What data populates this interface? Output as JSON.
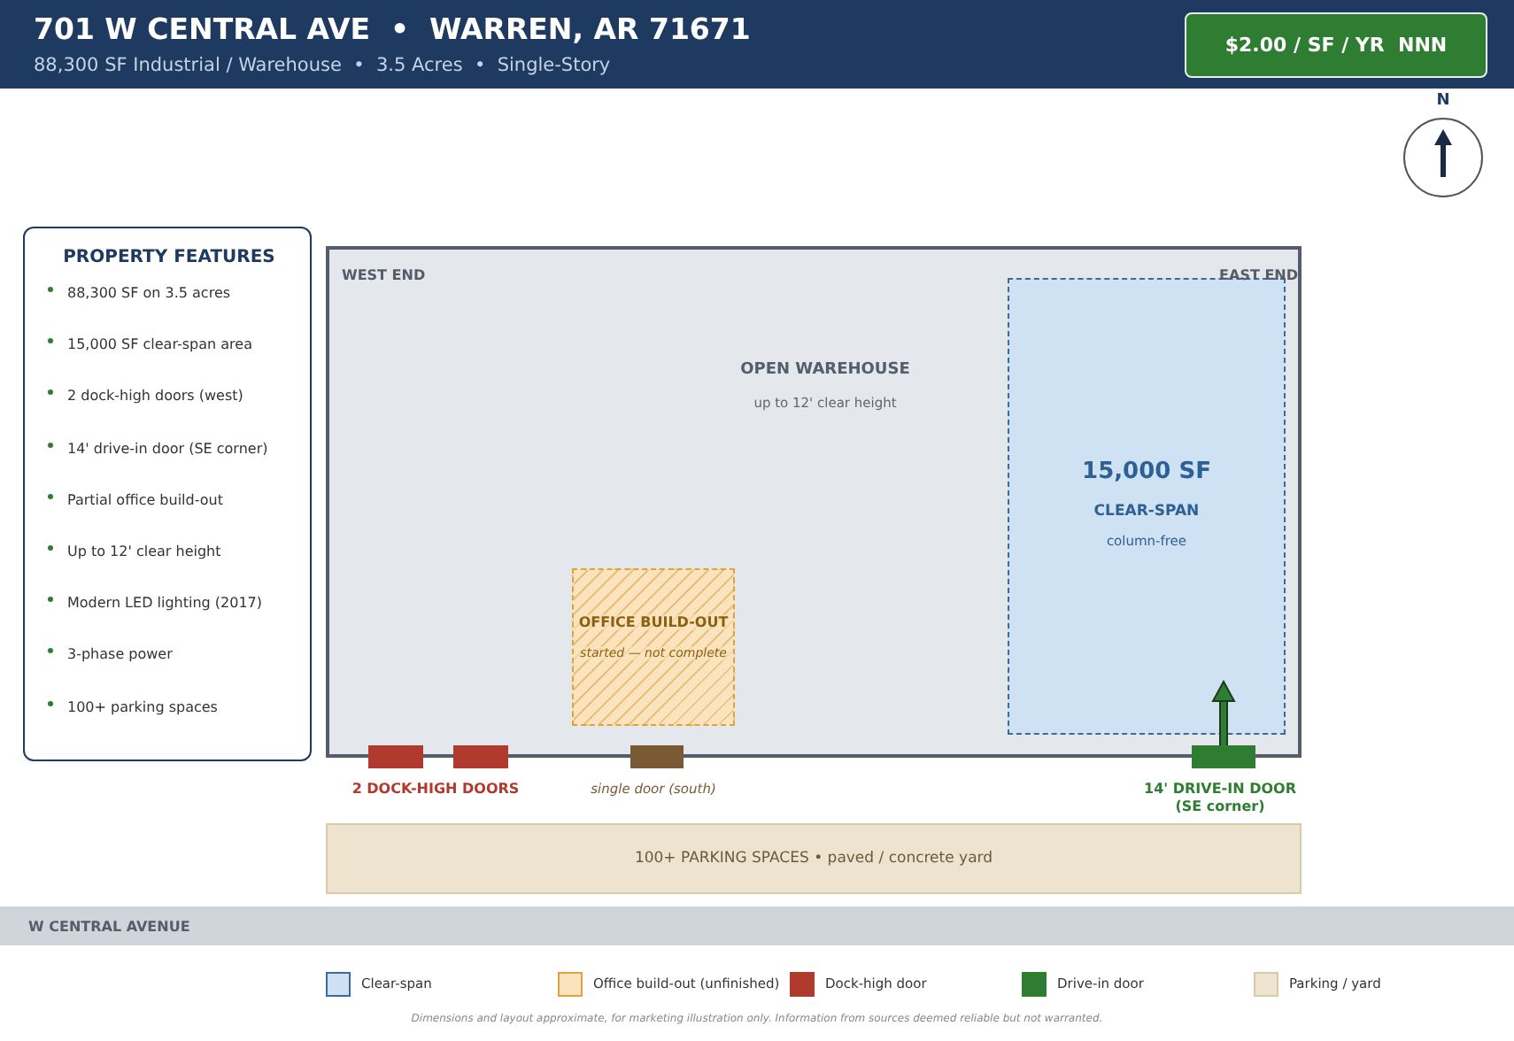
{
  "header": {
    "title": "701 W CENTRAL AVE  •  WARREN, AR 71671",
    "subtitle": "88,300 SF Industrial / Warehouse  •  3.5 Acres  •  Single-Story",
    "price": "$2.00 / SF / YR  NNN"
  },
  "compass": {
    "label": "N"
  },
  "features": {
    "title": "PROPERTY FEATURES",
    "items": [
      "88,300 SF on 3.5 acres",
      "15,000 SF clear-span area",
      "2 dock-high doors (west)",
      "14' drive-in door (SE corner)",
      "Partial office build-out",
      "Up to 12' clear height",
      "Modern LED lighting (2017)",
      "3-phase power",
      "100+ parking spaces"
    ]
  },
  "plan": {
    "west_label": "WEST END",
    "east_label": "EAST END",
    "open_area": {
      "title": "OPEN WAREHOUSE",
      "subtitle": "up to 12' clear height"
    },
    "zones": [
      {
        "kind": "clear-span",
        "value": "15,000 SF",
        "title": "CLEAR-SPAN",
        "note": "column-free"
      },
      {
        "kind": "office",
        "title": "OFFICE BUILD-OUT",
        "note": "started — not complete"
      }
    ],
    "doors": [
      {
        "kind": "dock"
      },
      {
        "kind": "dock"
      },
      {
        "kind": "single"
      },
      {
        "kind": "drive-in"
      }
    ],
    "door_labels": [
      {
        "kind": "dock",
        "text": "2 DOCK-HIGH DOORS"
      },
      {
        "kind": "single",
        "text": "single door (south)"
      },
      {
        "kind": "drive-in",
        "text": "14' DRIVE-IN DOOR (SE corner)"
      }
    ]
  },
  "parking": {
    "text": "100+ PARKING SPACES • paved / concrete yard"
  },
  "road": {
    "name": "W CENTRAL AVENUE"
  },
  "legend": [
    {
      "label": "Clear-span",
      "color": "#cfe2f3"
    },
    {
      "label": "Office build-out (unfinished)",
      "color": "#fbe3bd"
    },
    {
      "label": "Dock-high door",
      "color": "#b03a2e"
    },
    {
      "label": "Drive-in door",
      "color": "#2e7d32"
    },
    {
      "label": "Parking / yard",
      "color": "#ede3cf"
    }
  ],
  "footer": "Dimensions and layout approximate, for marketing illustration only. Information from sources deemed reliable but not warranted."
}
